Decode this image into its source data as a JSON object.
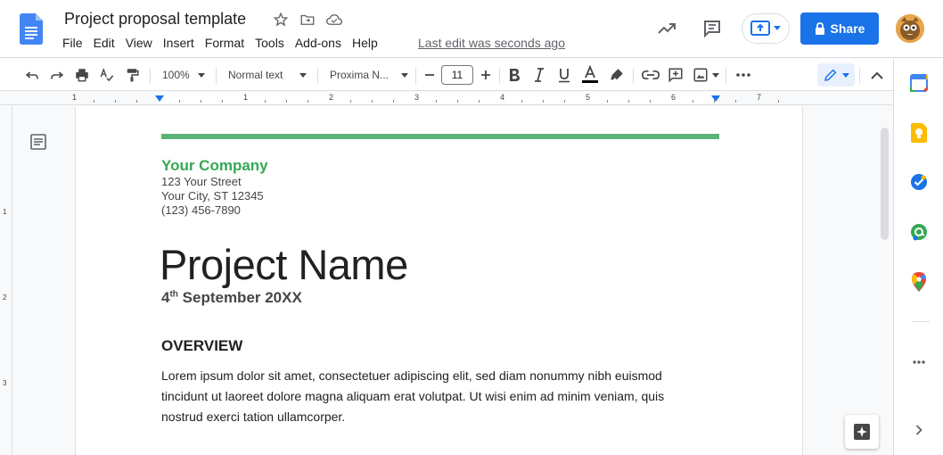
{
  "header": {
    "doc_title": "Project proposal template",
    "menu": [
      "File",
      "Edit",
      "View",
      "Insert",
      "Format",
      "Tools",
      "Add-ons",
      "Help"
    ],
    "last_edit": "Last edit was seconds ago",
    "share_label": "Share"
  },
  "toolbar": {
    "zoom": "100%",
    "style": "Normal text",
    "font": "Proxima N...",
    "font_size": "11"
  },
  "ruler": {
    "numbers": [
      "1",
      "1",
      "2",
      "3",
      "4",
      "5",
      "6",
      "7"
    ]
  },
  "vruler": {
    "numbers": [
      "1",
      "2",
      "3"
    ]
  },
  "document": {
    "company": "Your Company",
    "street": "123 Your Street",
    "city": "Your City, ST 12345",
    "phone": "(123) 456-7890",
    "project_name": "Project Name",
    "date_day": "4",
    "date_suffix": "th",
    "date_rest": " September 20XX",
    "overview_heading": "OVERVIEW",
    "body_lines": [
      "Lorem ipsum dolor sit amet, consectetuer adipiscing elit, sed diam nonummy nibh euismod",
      "tincidunt ut laoreet dolore magna aliquam erat volutpat. Ut wisi enim ad minim veniam, quis",
      "nostrud exerci tation ullamcorper."
    ]
  },
  "colors": {
    "accent_blue": "#1a73e8",
    "company_green": "#34a853",
    "bar_green": "#5cb377"
  }
}
